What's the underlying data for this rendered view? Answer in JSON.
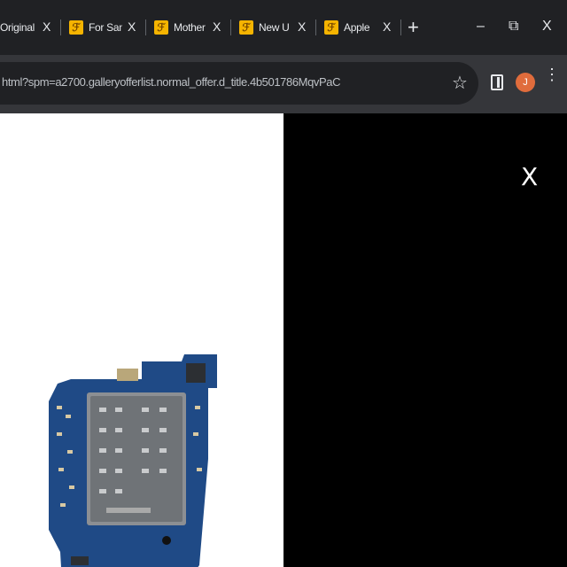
{
  "tabs": [
    {
      "title": "Original",
      "has_favicon": false
    },
    {
      "title": "For Sam",
      "has_favicon": true
    },
    {
      "title": "Mother",
      "has_favicon": true
    },
    {
      "title": "New U",
      "has_favicon": true
    },
    {
      "title": "Apple",
      "has_favicon": true
    }
  ],
  "tab_close_label": "X",
  "new_tab_label": "+",
  "window_controls": {
    "minimize": "–",
    "restore": "⧉",
    "close": "X"
  },
  "address_bar": {
    "url": "html?spm=a2700.galleryofferlist.normal_offer.d_title.4b501786MqvPaC"
  },
  "profile": {
    "initial": "J",
    "color": "#e06c3c"
  },
  "viewer": {
    "close_label": "X",
    "image_alt": "mobile phone motherboard with SIM card tray",
    "background": "#000000"
  },
  "colors": {
    "favicon": "#f5b400",
    "tabstrip": "#202124",
    "toolbar": "#35363a",
    "pcb": "#1f4a86"
  },
  "icons": [
    "star-icon",
    "sidepanel-icon",
    "menu-icon",
    "close-icon",
    "favicon-icon"
  ]
}
